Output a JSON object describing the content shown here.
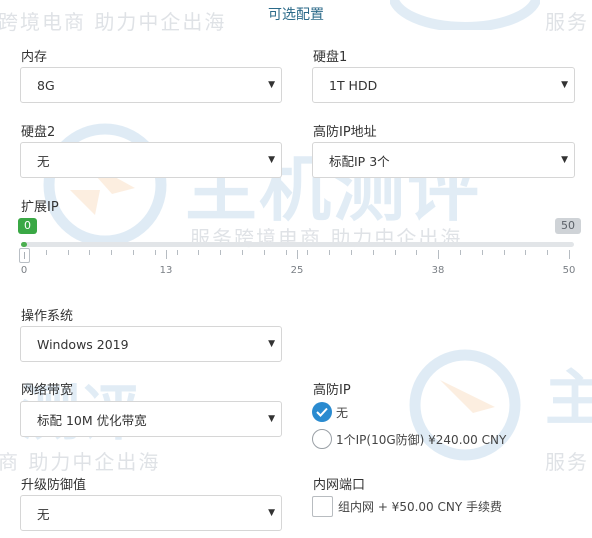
{
  "section": {
    "title": "可选配置"
  },
  "watermark": {
    "slogan": "服务跨境电商 助力中企出海",
    "slogan_partial_left": "跨境电商 助力中企出海",
    "slogan_partial_right": "服务",
    "slogan_partial_bottom_left": "商 助力中企出海",
    "brand": "主机测评",
    "brand_partial": "测评",
    "brand_partial_right": "主"
  },
  "memory": {
    "label": "内存",
    "value": "8G"
  },
  "disk1": {
    "label": "硬盘1",
    "value": "1T HDD"
  },
  "disk2": {
    "label": "硬盘2",
    "value": "无"
  },
  "ip_address": {
    "label": "高防IP地址",
    "value": "标配IP 3个"
  },
  "extra_ip": {
    "label": "扩展IP",
    "min_badge": "0",
    "max_badge": "50",
    "current": 0,
    "min": 0,
    "max": 50,
    "tick_labels": [
      "0",
      "13",
      "25",
      "38",
      "50"
    ]
  },
  "os": {
    "label": "操作系统",
    "value": "Windows 2019"
  },
  "bandwidth": {
    "label": "网络带宽",
    "value": "标配 10M 优化带宽"
  },
  "ddos_ip": {
    "label": "高防IP",
    "options": [
      {
        "label": "无",
        "selected": true
      },
      {
        "label": "1个IP(10G防御) ¥240.00 CNY",
        "selected": false
      }
    ]
  },
  "defense_upgrade": {
    "label": "升级防御值",
    "value": "无"
  },
  "lan_port": {
    "label": "内网端口",
    "option": "组内网 + ¥50.00 CNY 手续费",
    "checked": false
  },
  "colors": {
    "accent": "#2a8bd0",
    "slider_fill": "#4caf50",
    "title": "#2b6a89"
  }
}
